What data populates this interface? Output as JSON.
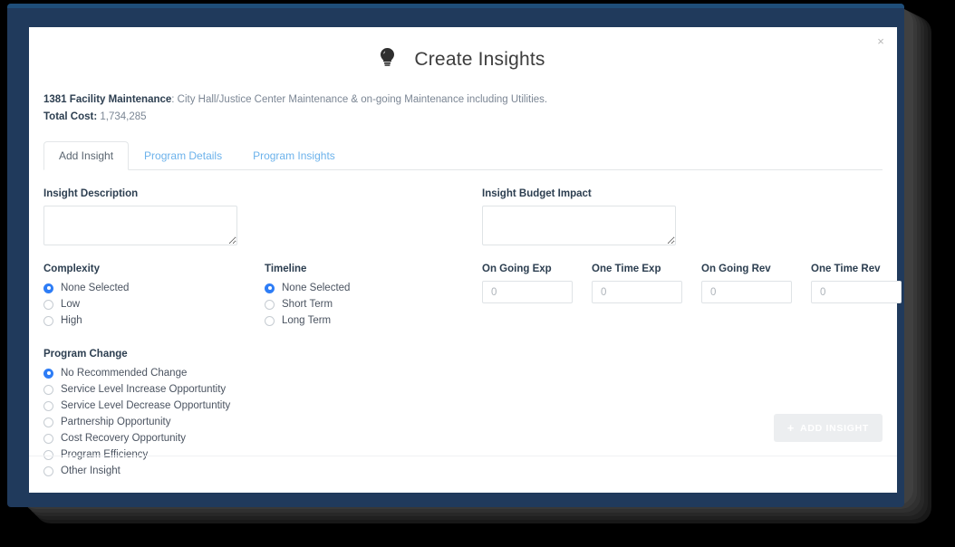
{
  "window": {
    "close_label": "×"
  },
  "header": {
    "icon": "lightbulb-icon",
    "title": "Create Insights"
  },
  "program": {
    "id": "1381",
    "name": "Facility Maintenance",
    "description": ": City Hall/Justice Center Maintenance & on-going Maintenance including Utilities.",
    "total_cost_label": "Total Cost:",
    "total_cost_value": "1,734,285"
  },
  "tabs": [
    {
      "label": "Add Insight",
      "active": true
    },
    {
      "label": "Program Details",
      "active": false
    },
    {
      "label": "Program Insights",
      "active": false
    }
  ],
  "form": {
    "insight_description": {
      "label": "Insight Description",
      "value": "",
      "placeholder": ""
    },
    "insight_budget_impact": {
      "label": "Insight Budget Impact",
      "value": "",
      "placeholder": ""
    },
    "complexity": {
      "label": "Complexity",
      "options": [
        {
          "label": "None Selected",
          "selected": true
        },
        {
          "label": "Low",
          "selected": false
        },
        {
          "label": "High",
          "selected": false
        }
      ]
    },
    "timeline": {
      "label": "Timeline",
      "options": [
        {
          "label": "None Selected",
          "selected": true
        },
        {
          "label": "Short Term",
          "selected": false
        },
        {
          "label": "Long Term",
          "selected": false
        }
      ]
    },
    "program_change": {
      "label": "Program Change",
      "options": [
        {
          "label": "No Recommended Change",
          "selected": true
        },
        {
          "label": "Service Level Increase Opportuntity",
          "selected": false
        },
        {
          "label": "Service Level Decrease Opportuntity",
          "selected": false
        },
        {
          "label": "Partnership Opportunity",
          "selected": false
        },
        {
          "label": "Cost Recovery Opportunity",
          "selected": false
        },
        {
          "label": "Program Efficiency",
          "selected": false
        },
        {
          "label": "Other Insight",
          "selected": false
        }
      ]
    },
    "budget_fields": [
      {
        "label": "On Going Exp",
        "value": "",
        "placeholder": "0"
      },
      {
        "label": "One Time Exp",
        "value": "",
        "placeholder": "0"
      },
      {
        "label": "On Going Rev",
        "value": "",
        "placeholder": "0"
      },
      {
        "label": "One Time Rev",
        "value": "",
        "placeholder": "0"
      }
    ]
  },
  "footer": {
    "add_insight_label": "ADD INSIGHT",
    "plus_icon": "+"
  },
  "colors": {
    "frame_navy": "#203a5c",
    "frame_accent": "#1f4e79",
    "tab_link": "#6cb2eb",
    "radio_selected": "#2e7df6",
    "heading_text": "#2c3e50"
  }
}
